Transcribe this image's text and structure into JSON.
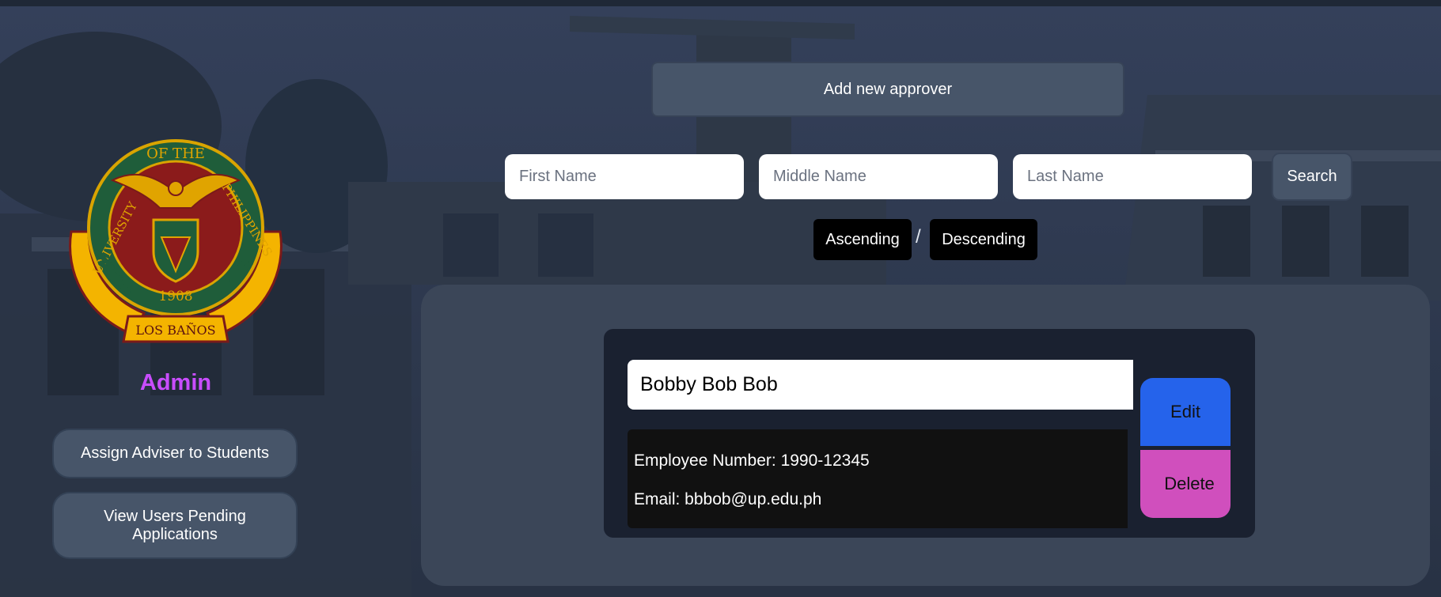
{
  "sidebar": {
    "role_title": "Admin",
    "seal": {
      "top_text": "OF THE",
      "left_text": "UNIVERSITY",
      "right_text": "PHILIPPINES",
      "year": "1908",
      "banner": "LOS BAÑOS"
    },
    "buttons": {
      "assign_adviser": "Assign Adviser to Students",
      "view_pending": "View Users Pending Applications"
    }
  },
  "toolbar": {
    "add_approver": "Add new approver",
    "search_label": "Search",
    "sort_ascending": "Ascending",
    "sort_separator": "/",
    "sort_descending": "Descending"
  },
  "search": {
    "first_name": {
      "placeholder": "First Name",
      "value": ""
    },
    "middle_name": {
      "placeholder": "Middle Name",
      "value": ""
    },
    "last_name": {
      "placeholder": "Last Name",
      "value": ""
    }
  },
  "approvers": [
    {
      "name": "Bobby Bob Bob",
      "employee_number": "Employee Number: 1990-12345",
      "email": "Email: bbbob@up.edu.ph",
      "edit_label": "Edit",
      "delete_label": "Delete"
    }
  ],
  "colors": {
    "admin_accent": "#c94dff",
    "edit": "#2563eb",
    "delete": "#d04fbd",
    "panel": "#3b4658",
    "card": "#1a2130"
  }
}
